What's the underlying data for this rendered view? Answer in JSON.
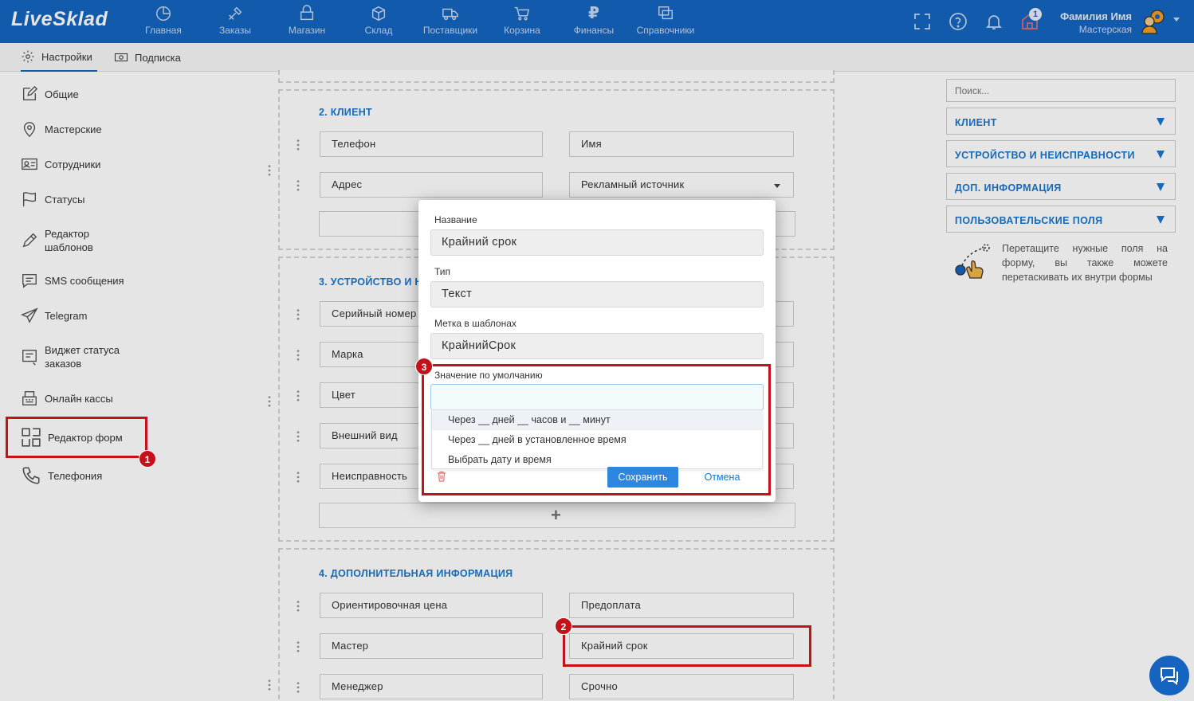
{
  "topbar": {
    "logo": "LiveSklad",
    "nav": [
      {
        "label": "Главная",
        "icon": "pie-chart-icon"
      },
      {
        "label": "Заказы",
        "icon": "tools-icon"
      },
      {
        "label": "Магазин",
        "icon": "shop-icon"
      },
      {
        "label": "Склад",
        "icon": "box-icon"
      },
      {
        "label": "Поставщики",
        "icon": "truck-icon"
      },
      {
        "label": "Корзина",
        "icon": "cart-icon"
      },
      {
        "label": "Финансы",
        "icon": "ruble-icon"
      },
      {
        "label": "Справочники",
        "icon": "copy-icon"
      }
    ],
    "notification_count": "1",
    "user_name": "Фамилия Имя",
    "user_role": "Мастерская",
    "accent": "#1565c0"
  },
  "subtabs": [
    {
      "label": "Настройки",
      "icon": "gear-icon"
    },
    {
      "label": "Подписка",
      "icon": "money-icon"
    }
  ],
  "sidebar": {
    "items": [
      {
        "label": "Общие",
        "icon": "edit-icon"
      },
      {
        "label": "Мастерские",
        "icon": "location-pin-icon"
      },
      {
        "label": "Сотрудники",
        "icon": "id-card-icon"
      },
      {
        "label": "Статусы",
        "icon": "flag-icon"
      },
      {
        "label": "Редактор шаблонов",
        "icon": "pencil-icon"
      },
      {
        "label": "SMS сообщения",
        "icon": "message-icon"
      },
      {
        "label": "Telegram",
        "icon": "send-icon"
      },
      {
        "label": "Виджет статуса заказов",
        "icon": "widget-icon"
      },
      {
        "label": "Онлайн кассы",
        "icon": "cash-register-icon"
      },
      {
        "label": "Редактор форм",
        "icon": "form-editor-icon"
      },
      {
        "label": "Телефония",
        "icon": "phone-icon"
      }
    ]
  },
  "form": {
    "sections": [
      {
        "title": "2. КЛИЕНТ",
        "fields": [
          "Телефон",
          "Имя",
          "Адрес",
          "Рекламный источник"
        ]
      },
      {
        "title": "3. УСТРОЙСТВО И Н",
        "fields": [
          "Серийный номер",
          "Марка",
          "Цвет",
          "Внешний вид",
          "Неисправность"
        ]
      },
      {
        "title": "4. ДОПОЛНИТЕЛЬНАЯ ИНФОРМАЦИЯ",
        "fields": [
          "Ориентировочная цена",
          "Предоплата",
          "Мастер",
          "Крайний срок",
          "Менеджер",
          "Срочно"
        ]
      }
    ]
  },
  "right_panel": {
    "search_placeholder": "Поиск...",
    "groups": [
      "КЛИЕНТ",
      "УСТРОЙСТВО И НЕИСПРАВНОСТИ",
      "ДОП. ИНФОРМАЦИЯ",
      "ПОЛЬЗОВАТЕЛЬСКИЕ ПОЛЯ"
    ],
    "hint_lines": [
      "Перетащите нужные поля на",
      "форму, вы также можете",
      "перетаскивать их внутри формы"
    ]
  },
  "modal": {
    "name_label": "Название",
    "name_value": "Крайний срок",
    "type_label": "Тип",
    "type_value": "Текст",
    "tag_label": "Метка в шаблонах",
    "tag_value": "КрайнийСрок",
    "default_label": "Значение по умолчанию",
    "default_value": "",
    "options": [
      "Через __ дней __ часов и __ минут",
      "Через __ дней в установленное время",
      "Выбрать дату и время"
    ],
    "save_label": "Сохранить",
    "cancel_label": "Отмена"
  },
  "annotations": {
    "one": "1",
    "two": "2",
    "three": "3",
    "color": "#c4121a"
  }
}
